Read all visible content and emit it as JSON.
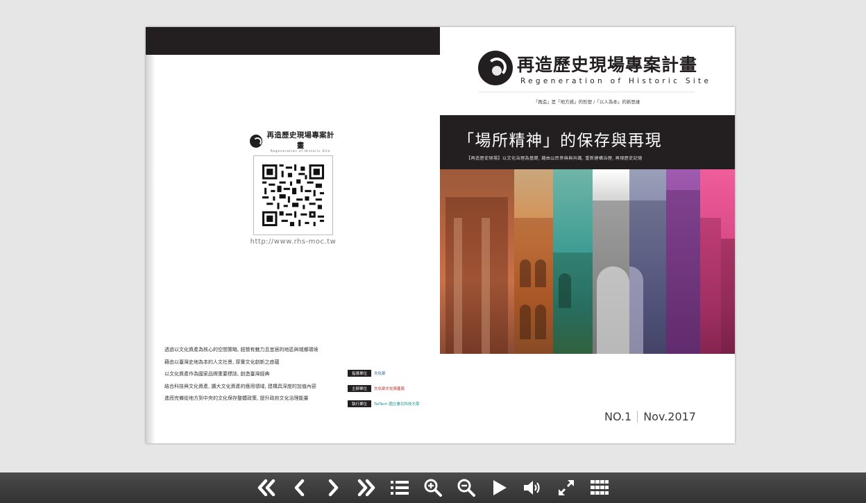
{
  "cover": {
    "logo_title": "再造歷史現場專案計畫",
    "logo_eng": "Regeneration of Historic Site",
    "tagline": "「再造」是「地方感」的形塑 /「以人為本」的新思維",
    "headline": "「場所精神」的保存與再現",
    "subheadline": "【再造歷史現場】以文化治理為基礎, 藉由公民參與與共識, 重新建構治理, 再現歷史記憶",
    "issue_no": "NO.1",
    "issue_date": "Nov.2017"
  },
  "back": {
    "logo_title": "再造歷史現場專案計畫",
    "logo_eng": "Regeneration of Historic Site",
    "url": "http://www.rhs-moc.tw",
    "mission": [
      "透過以文化資產為核心的空間策略, 經營有魅力且宜居的地區與城鄉環境",
      "藉由以臺灣史地為本的人文社景, 厚實文化創新之底蘊",
      "以文化資產作為國家品牌重要標誌, 創造臺灣經典",
      "結合科技與文化資產, 擴大文化資產的應用領域, 建構具深度的加值內容",
      "進而完備從地方到中央的文化保存整體政策, 提升政府文化治理能量"
    ],
    "partners": [
      {
        "role": "指導單位",
        "org": "文化部"
      },
      {
        "role": "主辦單位",
        "org": "文化部文化資產局"
      },
      {
        "role": "執行單位",
        "org": "TaiTech 國立臺北科技大學"
      }
    ]
  },
  "toolbar": {
    "buttons": [
      {
        "name": "first-page-icon"
      },
      {
        "name": "previous-page-icon"
      },
      {
        "name": "next-page-icon"
      },
      {
        "name": "last-page-icon"
      },
      {
        "name": "table-of-contents-icon"
      },
      {
        "name": "zoom-in-icon"
      },
      {
        "name": "zoom-out-icon"
      },
      {
        "name": "autoplay-icon"
      },
      {
        "name": "sound-icon"
      },
      {
        "name": "fullscreen-icon"
      },
      {
        "name": "thumbnails-icon"
      }
    ]
  },
  "colors": {
    "background": "#e6e6e6",
    "band": "#231f20",
    "toolbar": "#3a3a3a"
  }
}
